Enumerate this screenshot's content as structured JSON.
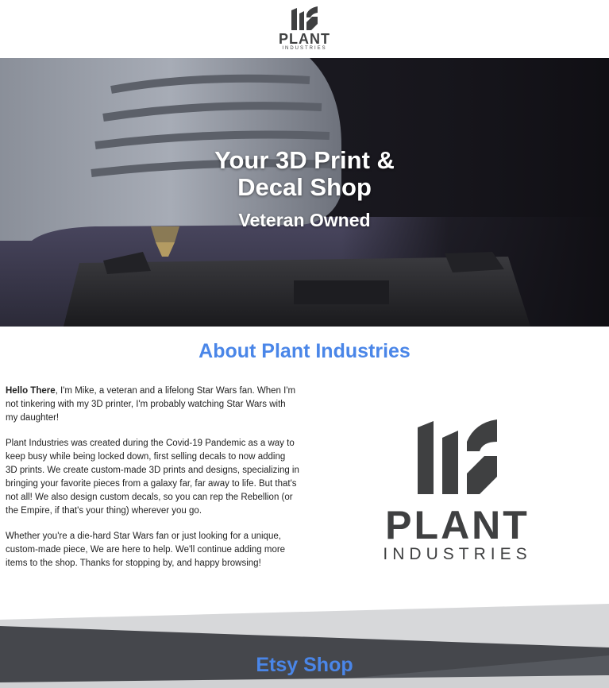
{
  "header": {
    "logo": {
      "icon": "plant-industries-logo-icon",
      "word": "PLANT",
      "sub": "INDUSTRIES"
    }
  },
  "hero": {
    "title": "Your 3D Print & Decal Shop",
    "subtitle": "Veteran Owned"
  },
  "about": {
    "heading": "About Plant Industries",
    "intro_bold": "Hello There",
    "intro_rest": ", I'm Mike, a veteran and a lifelong Star Wars fan. When I'm not tinkering with my 3D printer, I'm probably watching Star Wars with my daughter!",
    "paragraph2": "Plant Industries was created during the Covid-19 Pandemic as a way to keep busy while being locked down, first selling decals to now adding 3D prints. We create custom-made 3D prints and designs, specializing in bringing your favorite pieces from a galaxy far, far away to life. But that's not all! We also design custom decals, so you can rep the Rebellion (or the Empire, if that's your thing) wherever you go.",
    "paragraph3": "Whether you're a die-hard Star Wars fan or just looking for a unique, custom-made piece, We are here to help. We'll continue adding more items to the shop. Thanks for stopping by, and happy browsing!",
    "logo": {
      "word": "PLANT",
      "sub": "INDUSTRIES"
    }
  },
  "etsy": {
    "heading": "Etsy Shop"
  },
  "colors": {
    "accent": "#4a86e8",
    "logo": "#3f4041",
    "band_dark": "#45474c",
    "band_light": "#d7d8da"
  }
}
